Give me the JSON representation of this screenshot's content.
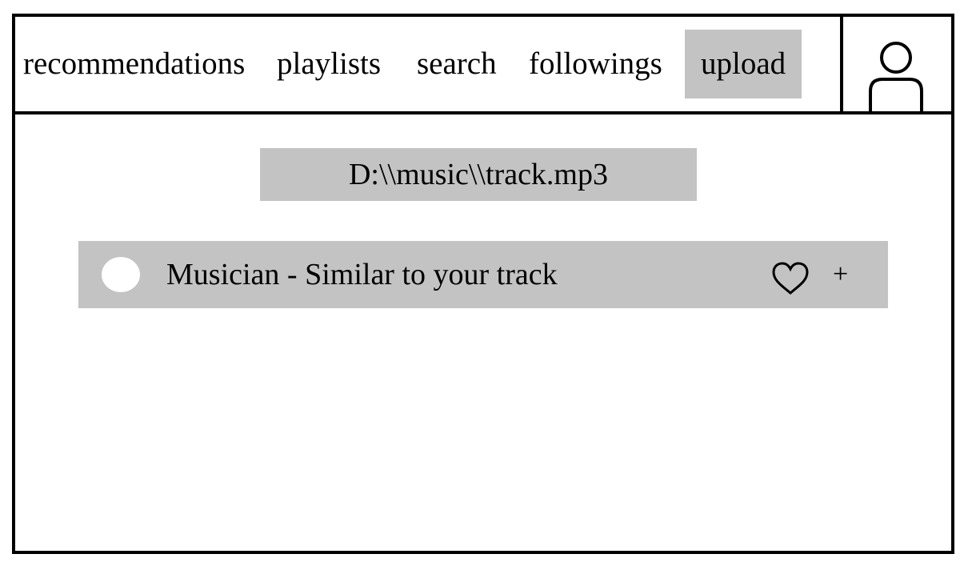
{
  "nav": {
    "items": [
      {
        "label": "recommendations"
      },
      {
        "label": "playlists"
      },
      {
        "label": "search"
      },
      {
        "label": "followings"
      },
      {
        "label": "upload",
        "active": true
      }
    ],
    "profile_icon": "user-avatar-icon"
  },
  "upload": {
    "file_path": "D:\\\\music\\\\track.mp3"
  },
  "results": [
    {
      "title": "Musician - Similar to your track",
      "cover_icon": "circle-cover-icon",
      "like_icon": "heart-icon",
      "add_label": "+"
    }
  ],
  "colors": {
    "highlight": "#c3c3c3",
    "border": "#000000",
    "background": "#ffffff"
  }
}
